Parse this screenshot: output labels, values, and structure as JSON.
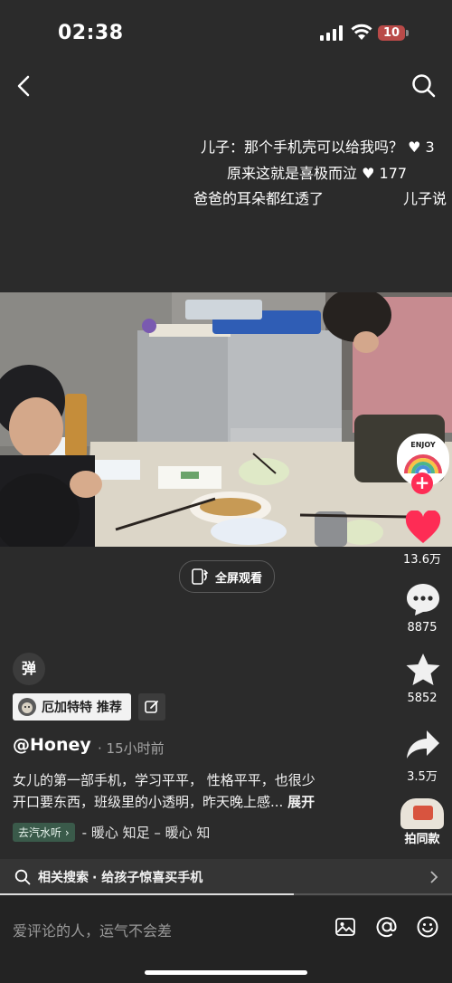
{
  "status_bar": {
    "time": "02:38",
    "battery": "10"
  },
  "danmaku": [
    {
      "text": "儿子：那个手机壳可以给我吗？",
      "likes": "3"
    },
    {
      "text": "原来这就是喜极而泣",
      "likes": "177"
    },
    {
      "text": "爸爸的耳朵都红透了"
    },
    {
      "text": "儿子说"
    }
  ],
  "video": {
    "fullscreen_label": "全屏观看"
  },
  "rail": {
    "like_count": "13.6万",
    "comment_count": "8875",
    "favorite_count": "5852",
    "share_count": "3.5万",
    "same_style_label": "拍同款",
    "avatar_text": "ENJOY"
  },
  "danmu_button": "弹",
  "tag": {
    "label": "厄加特特 推荐"
  },
  "author": "@Honey",
  "time_ago": "· 15小时前",
  "description": {
    "line1": "女儿的第一部手机，学习平平， 性格平平，也很少",
    "line2": "开口要东西，班级里的小透明，昨天晚上感...",
    "expand": "展开"
  },
  "music": {
    "chip": "去汽水听",
    "track": "- 暖心    知足 – 暖心    知"
  },
  "related_search": {
    "prefix": "相关搜索",
    "query": "· 给孩子惊喜买手机"
  },
  "comment_placeholder": "爱评论的人，运气不会差",
  "colors": {
    "like": "#fe2c55",
    "background": "#2b2b2b"
  }
}
